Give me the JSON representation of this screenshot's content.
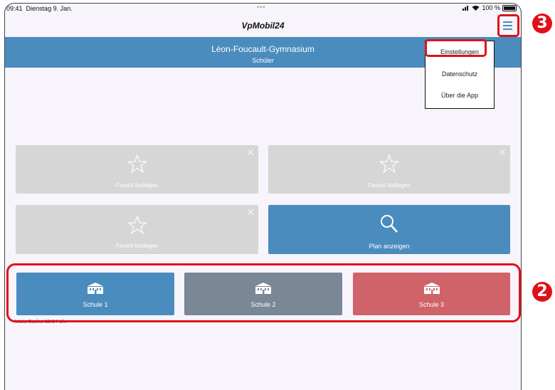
{
  "status_bar": {
    "time": "09:41",
    "date": "Dienstag 9. Jan.",
    "multitask_dots": "•••",
    "battery": "100 %"
  },
  "nav": {
    "title": "VpMobil24",
    "menu_icon": "hamburger-icon"
  },
  "header": {
    "school_name": "Léon-Foucault-Gymnasium",
    "role": "Schüler",
    "color": "#4a8cbe"
  },
  "tiles": [
    {
      "label": "Favorit festlegen",
      "icon": "star-icon",
      "removable": true
    },
    {
      "label": "Favorit festlegen",
      "icon": "star-icon",
      "removable": true
    },
    {
      "label": "Favorit festlegen",
      "icon": "star-icon",
      "removable": true
    },
    {
      "label": "Plan anzeigen",
      "icon": "search-icon",
      "removable": false
    }
  ],
  "schools": [
    {
      "label": "Schule 1",
      "icon": "school-building-icon",
      "color": "#4a8cbe"
    },
    {
      "label": "Schule 2",
      "icon": "school-building-icon",
      "color": "#7a8797"
    },
    {
      "label": "Schule 3",
      "icon": "school-building-icon",
      "color": "#d0626a"
    }
  ],
  "last_search": "letzte Suche: 10:54 Uhr",
  "menu": {
    "items": [
      "Einstellungen",
      "Datenschutz",
      "Über die App"
    ]
  },
  "annotations": {
    "badge_2": "2",
    "badge_3": "3",
    "highlight_color": "#e01018"
  }
}
